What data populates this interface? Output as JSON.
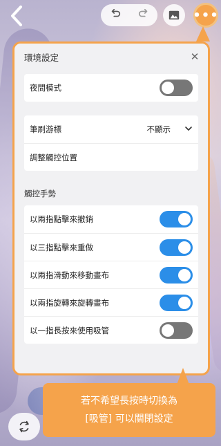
{
  "panel": {
    "title": "環境設定",
    "close_icon": "close-icon"
  },
  "night_mode": {
    "label": "夜間模式",
    "on": false
  },
  "brush_cursor": {
    "label": "筆刷游標",
    "value": "不顯示"
  },
  "adjust_touch": {
    "label": "調整觸控位置"
  },
  "gestures": {
    "section_label": "觸控手勢",
    "items": [
      {
        "label": "以兩指點擊來撤銷",
        "on": true
      },
      {
        "label": "以三指點擊來重做",
        "on": true
      },
      {
        "label": "以兩指滑動來移動畫布",
        "on": true
      },
      {
        "label": "以兩指旋轉來旋轉畫布",
        "on": true
      },
      {
        "label": "以一指長按來使用吸管",
        "on": false
      }
    ]
  },
  "callout": {
    "line1": "若不希望長按時切換為",
    "line2": "[吸管] 可以關閉設定"
  },
  "colors": {
    "accent": "#f5a34b",
    "toggle_on": "#2b8ee8",
    "toggle_off": "#777777"
  },
  "icons": {
    "back": "back-chevron-icon",
    "undo": "undo-icon",
    "redo": "redo-icon",
    "image": "image-icon",
    "more": "more-dots-icon",
    "bottom": "swap-color-icon"
  }
}
